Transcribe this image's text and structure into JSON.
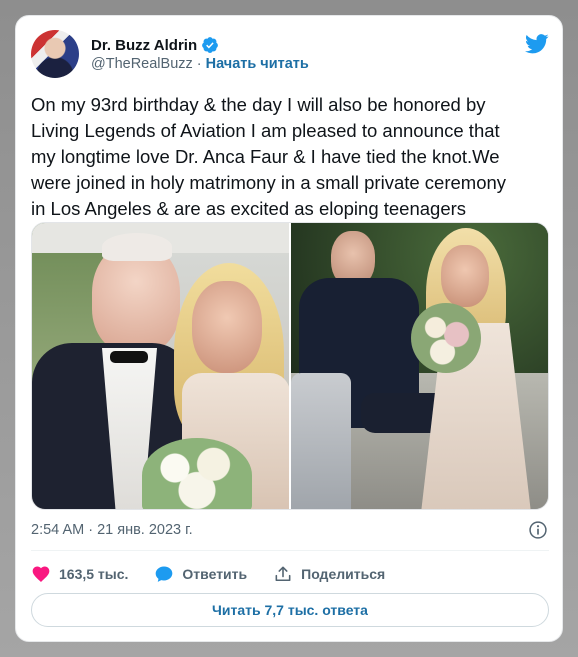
{
  "author": {
    "display_name": "Dr. Buzz Aldrin",
    "handle": "@TheRealBuzz",
    "separator": "·",
    "follow_label": "Начать читать",
    "verified": true
  },
  "tweet": {
    "text": "On my 93rd birthday & the day I will also be honored by\nLiving Legends of Aviation I am pleased to announce that\nmy longtime love Dr. Anca Faur & I have tied the knot.We\nwere joined in holy matrimony in a small private ceremony\nin Los Angeles & are as excited as eloping teenagers",
    "timestamp": "2:54 AM · 21 янв. 2023 г."
  },
  "actions": {
    "like_count": "163,5 тыс.",
    "reply_label": "Ответить",
    "share_label": "Поделиться"
  },
  "replies_button_label": "Читать 7,7 тыс. ответа",
  "colors": {
    "accent": "#1d9bf0",
    "like": "#f91880",
    "reply": "#1d9bf0",
    "link": "#1d6fa5",
    "text": "#0f1419",
    "muted": "#536471"
  },
  "icons": {
    "brand": "twitter-bird-icon",
    "verified": "verified-badge-icon",
    "info": "info-icon",
    "like": "heart-icon",
    "reply": "speech-bubble-icon",
    "share": "share-upload-icon"
  }
}
